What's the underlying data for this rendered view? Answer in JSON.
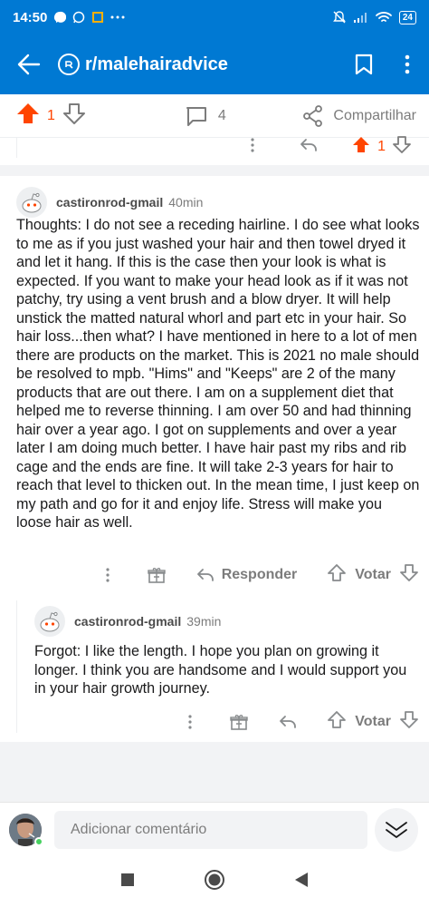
{
  "status_bar": {
    "time": "14:50",
    "battery": "24"
  },
  "app_bar": {
    "subreddit": "r/malehairadvice"
  },
  "post_actions": {
    "score": "1",
    "comments": "4",
    "share_label": "Compartilhar"
  },
  "previous_comment": {
    "score": "1"
  },
  "comments": [
    {
      "username": "castironrod-gmail",
      "time": "40min",
      "body": "Thoughts: I do not see a receding hairline.  I do see what looks to me as if you just washed your hair and then towel dryed it and let it hang.  If this is the case then your look is what is expected.  If you want to make your head look as if it was not patchy, try using a vent brush and a blow dryer.  It will help unstick the matted natural whorl and part etc in your hair.  So hair loss...then what?  I have mentioned in here to a lot of men there are products on the market.  This is 2021 no male should be resolved to mpb.  \"Hims\" and \"Keeps\" are 2 of the many products that are out there.  I am on a supplement diet that helped me to reverse thinning.  I am over 50 and had thinning hair over a year ago.  I got on supplements and over a year later I am doing much better.  I have hair past my ribs and rib cage and the ends are fine.  It will take 2-3 years for hair to reach that level to thicken out.  In the mean time, I just keep on my path and go for it and enjoy life.  Stress will  make you loose hair as well.",
      "reply_label": "Responder",
      "vote_label": "Votar"
    },
    {
      "username": "castironrod-gmail",
      "time": "39min",
      "body": "Forgot: I like the length.  I hope you plan on growing it longer.  I think you are handsome and I would support you in your hair growth journey.",
      "vote_label": "Votar"
    }
  ],
  "composer": {
    "placeholder": "Adicionar comentário"
  }
}
